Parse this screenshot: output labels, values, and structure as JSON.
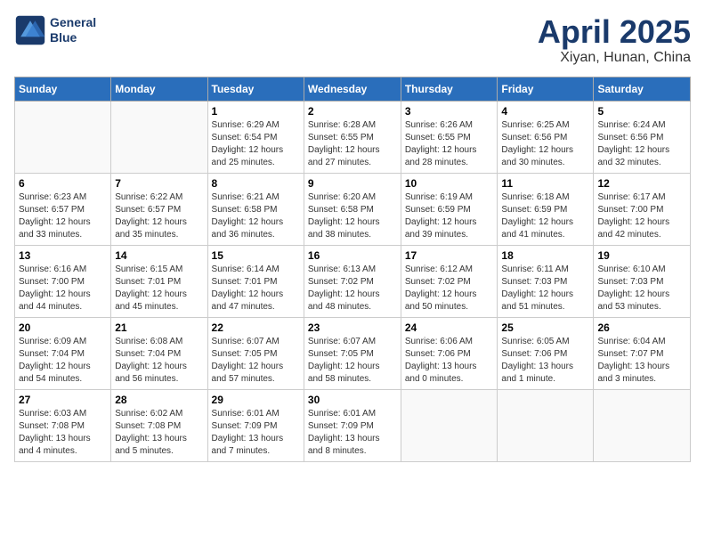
{
  "header": {
    "logo_line1": "General",
    "logo_line2": "Blue",
    "month_year": "April 2025",
    "location": "Xiyan, Hunan, China"
  },
  "weekdays": [
    "Sunday",
    "Monday",
    "Tuesday",
    "Wednesday",
    "Thursday",
    "Friday",
    "Saturday"
  ],
  "weeks": [
    [
      {
        "day": "",
        "detail": ""
      },
      {
        "day": "",
        "detail": ""
      },
      {
        "day": "1",
        "detail": "Sunrise: 6:29 AM\nSunset: 6:54 PM\nDaylight: 12 hours and 25 minutes."
      },
      {
        "day": "2",
        "detail": "Sunrise: 6:28 AM\nSunset: 6:55 PM\nDaylight: 12 hours and 27 minutes."
      },
      {
        "day": "3",
        "detail": "Sunrise: 6:26 AM\nSunset: 6:55 PM\nDaylight: 12 hours and 28 minutes."
      },
      {
        "day": "4",
        "detail": "Sunrise: 6:25 AM\nSunset: 6:56 PM\nDaylight: 12 hours and 30 minutes."
      },
      {
        "day": "5",
        "detail": "Sunrise: 6:24 AM\nSunset: 6:56 PM\nDaylight: 12 hours and 32 minutes."
      }
    ],
    [
      {
        "day": "6",
        "detail": "Sunrise: 6:23 AM\nSunset: 6:57 PM\nDaylight: 12 hours and 33 minutes."
      },
      {
        "day": "7",
        "detail": "Sunrise: 6:22 AM\nSunset: 6:57 PM\nDaylight: 12 hours and 35 minutes."
      },
      {
        "day": "8",
        "detail": "Sunrise: 6:21 AM\nSunset: 6:58 PM\nDaylight: 12 hours and 36 minutes."
      },
      {
        "day": "9",
        "detail": "Sunrise: 6:20 AM\nSunset: 6:58 PM\nDaylight: 12 hours and 38 minutes."
      },
      {
        "day": "10",
        "detail": "Sunrise: 6:19 AM\nSunset: 6:59 PM\nDaylight: 12 hours and 39 minutes."
      },
      {
        "day": "11",
        "detail": "Sunrise: 6:18 AM\nSunset: 6:59 PM\nDaylight: 12 hours and 41 minutes."
      },
      {
        "day": "12",
        "detail": "Sunrise: 6:17 AM\nSunset: 7:00 PM\nDaylight: 12 hours and 42 minutes."
      }
    ],
    [
      {
        "day": "13",
        "detail": "Sunrise: 6:16 AM\nSunset: 7:00 PM\nDaylight: 12 hours and 44 minutes."
      },
      {
        "day": "14",
        "detail": "Sunrise: 6:15 AM\nSunset: 7:01 PM\nDaylight: 12 hours and 45 minutes."
      },
      {
        "day": "15",
        "detail": "Sunrise: 6:14 AM\nSunset: 7:01 PM\nDaylight: 12 hours and 47 minutes."
      },
      {
        "day": "16",
        "detail": "Sunrise: 6:13 AM\nSunset: 7:02 PM\nDaylight: 12 hours and 48 minutes."
      },
      {
        "day": "17",
        "detail": "Sunrise: 6:12 AM\nSunset: 7:02 PM\nDaylight: 12 hours and 50 minutes."
      },
      {
        "day": "18",
        "detail": "Sunrise: 6:11 AM\nSunset: 7:03 PM\nDaylight: 12 hours and 51 minutes."
      },
      {
        "day": "19",
        "detail": "Sunrise: 6:10 AM\nSunset: 7:03 PM\nDaylight: 12 hours and 53 minutes."
      }
    ],
    [
      {
        "day": "20",
        "detail": "Sunrise: 6:09 AM\nSunset: 7:04 PM\nDaylight: 12 hours and 54 minutes."
      },
      {
        "day": "21",
        "detail": "Sunrise: 6:08 AM\nSunset: 7:04 PM\nDaylight: 12 hours and 56 minutes."
      },
      {
        "day": "22",
        "detail": "Sunrise: 6:07 AM\nSunset: 7:05 PM\nDaylight: 12 hours and 57 minutes."
      },
      {
        "day": "23",
        "detail": "Sunrise: 6:07 AM\nSunset: 7:05 PM\nDaylight: 12 hours and 58 minutes."
      },
      {
        "day": "24",
        "detail": "Sunrise: 6:06 AM\nSunset: 7:06 PM\nDaylight: 13 hours and 0 minutes."
      },
      {
        "day": "25",
        "detail": "Sunrise: 6:05 AM\nSunset: 7:06 PM\nDaylight: 13 hours and 1 minute."
      },
      {
        "day": "26",
        "detail": "Sunrise: 6:04 AM\nSunset: 7:07 PM\nDaylight: 13 hours and 3 minutes."
      }
    ],
    [
      {
        "day": "27",
        "detail": "Sunrise: 6:03 AM\nSunset: 7:08 PM\nDaylight: 13 hours and 4 minutes."
      },
      {
        "day": "28",
        "detail": "Sunrise: 6:02 AM\nSunset: 7:08 PM\nDaylight: 13 hours and 5 minutes."
      },
      {
        "day": "29",
        "detail": "Sunrise: 6:01 AM\nSunset: 7:09 PM\nDaylight: 13 hours and 7 minutes."
      },
      {
        "day": "30",
        "detail": "Sunrise: 6:01 AM\nSunset: 7:09 PM\nDaylight: 13 hours and 8 minutes."
      },
      {
        "day": "",
        "detail": ""
      },
      {
        "day": "",
        "detail": ""
      },
      {
        "day": "",
        "detail": ""
      }
    ]
  ]
}
